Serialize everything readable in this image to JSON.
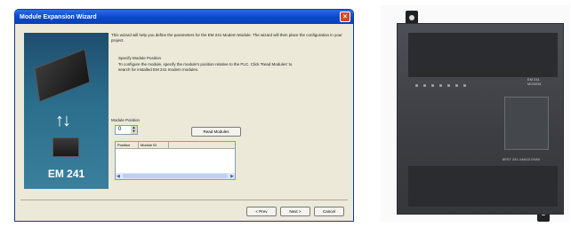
{
  "window": {
    "title": "Module Expansion Wizard",
    "close_glyph": "×"
  },
  "sidepanel": {
    "label": "EM 241",
    "arrows_glyph": "↑↓"
  },
  "content": {
    "intro": "This wizard will help you define the parameters for the EM 241 Modem Module. The wizard will then place the configuration in your project.",
    "section_title": "Specify Module Position",
    "section_body": "To configure the module, specify the module's position relative to the PLC. Click 'Read Modules' to search for installed EM 241 modem modules.",
    "position_label": "Module Position",
    "position_value": "0",
    "read_button": "Read Modules",
    "list_headers": [
      "Position",
      "Module ID"
    ]
  },
  "footer": {
    "prev": "< Prev",
    "next": "Next >",
    "cancel": "Cancel"
  },
  "device": {
    "brand": "EM 241",
    "model": "MODEM",
    "order_number": "6ES7 241-1AA22-0XA0"
  }
}
